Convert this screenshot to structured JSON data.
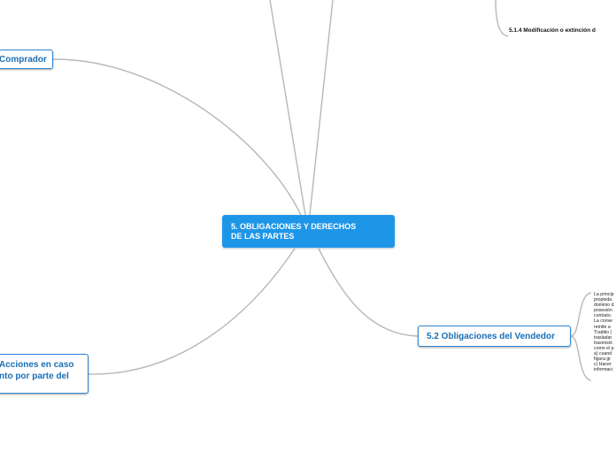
{
  "root": {
    "line1": "5. OBLIGACIONES Y DERECHOS",
    "line2": "DE LAS PARTES"
  },
  "nodes": {
    "comprador": "Comprador",
    "vendedor": "5.2 Obligaciones del Vendedor",
    "acciones_line1": "Acciones en caso",
    "acciones_line2": "nto por parte del"
  },
  "subtopic": {
    "label": "5.1.4 Modificación o extinción d"
  },
  "paragraph": {
    "lines": [
      "La princip",
      "propieda",
      "dominio d",
      "posesión",
      "contrato.",
      "La conve",
      "remite a",
      "Traditio (",
      "trasladar",
      "trasmisió",
      "como el p",
      "a) cuand",
      "figura gr",
      "c) Hacer",
      "informaci"
    ]
  },
  "colors": {
    "root_bg": "#1e96e8",
    "node_border": "#2f86d1",
    "node_text": "#1a6fb5",
    "connector": "#b8b8b8"
  }
}
